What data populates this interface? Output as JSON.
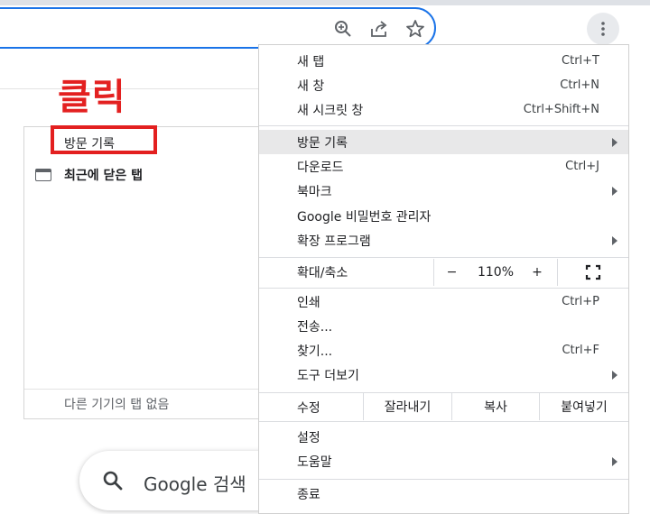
{
  "toolbar": {
    "icons": [
      "zoom-icon",
      "share-icon",
      "bookmark-star-icon",
      "more-vert-icon"
    ]
  },
  "annotation": {
    "label": "클릭"
  },
  "history_submenu": {
    "title": "방문 기록",
    "recently_closed": "최근에 닫은 탭",
    "footer": "다른 기기의 탭 없음"
  },
  "menu": {
    "new_tab": {
      "label": "새 탭",
      "shortcut": "Ctrl+T"
    },
    "new_window": {
      "label": "새 창",
      "shortcut": "Ctrl+N"
    },
    "incognito": {
      "label": "새 시크릿 창",
      "shortcut": "Ctrl+Shift+N"
    },
    "history": {
      "label": "방문 기록"
    },
    "downloads": {
      "label": "다운로드",
      "shortcut": "Ctrl+J"
    },
    "bookmarks": {
      "label": "북마크"
    },
    "passwords": {
      "label": "Google 비밀번호 관리자"
    },
    "extensions": {
      "label": "확장 프로그램"
    },
    "zoom": {
      "label": "확대/축소",
      "minus": "−",
      "value": "110%",
      "plus": "+"
    },
    "print": {
      "label": "인쇄",
      "shortcut": "Ctrl+P"
    },
    "cast": {
      "label": "전송..."
    },
    "find": {
      "label": "찾기...",
      "shortcut": "Ctrl+F"
    },
    "more_tools": {
      "label": "도구 더보기"
    },
    "edit": {
      "label": "수정",
      "cut": "잘라내기",
      "copy": "복사",
      "paste": "붙여넣기"
    },
    "settings": {
      "label": "설정"
    },
    "help": {
      "label": "도움말"
    },
    "exit": {
      "label": "종료"
    }
  },
  "search": {
    "text": "Google 검색"
  },
  "colors": {
    "accent": "#1a73e8",
    "annotation": "#e32020",
    "highlight": "#e8e8e9"
  }
}
